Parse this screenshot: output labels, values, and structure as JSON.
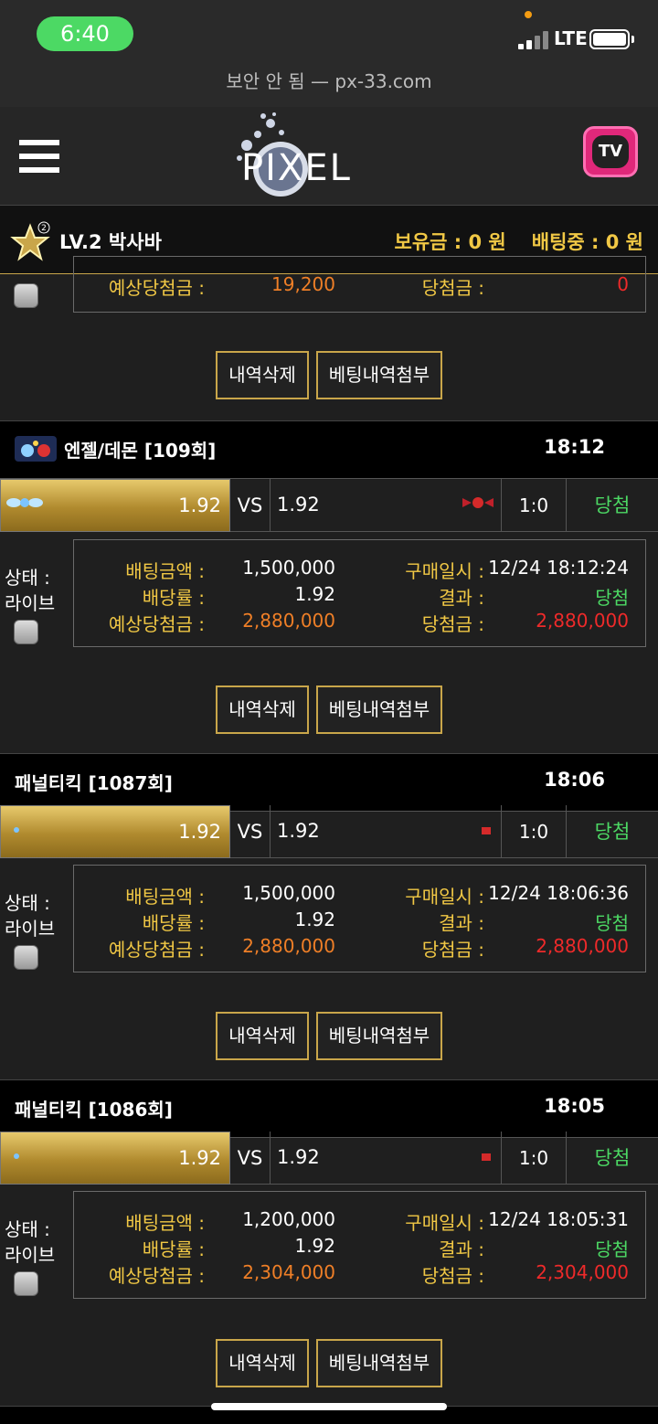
{
  "status_bar": {
    "time": "6:40",
    "network": "LTE"
  },
  "browser": {
    "url_text": "보안 안 됨 — px-33.com"
  },
  "header": {
    "logo_text": "PIXEL",
    "tv_label": "TV"
  },
  "user": {
    "level_name": "LV.2 박사바",
    "level_badge": "2",
    "balance": "보유금 : 0 원",
    "betting": "배팅중 : 0 원"
  },
  "labels": {
    "status_line1": "상태 :",
    "status_line2": "라이브",
    "bet_amount": "배팅금액 :",
    "odds": "배당률 :",
    "expected_win": "예상당첨금 :",
    "purchase_time": "구매일시 :",
    "result": "결과 :",
    "win_amount": "당첨금 :",
    "vs": "VS",
    "delete_button": "내역삭제",
    "attach_button": "베팅내역첨부"
  },
  "partial_card": {
    "expected_win": "19,200",
    "win_amount": "0"
  },
  "cards": [
    {
      "title": "엔젤/데몬 [109회]",
      "time": "18:12",
      "home_odds": "1.92",
      "away_odds": "1.92",
      "score": "1:0",
      "outcome": "당첨",
      "bet_amount": "1,500,000",
      "odds": "1.92",
      "expected_win": "2,880,000",
      "purchase_time": "12/24 18:12:24",
      "result": "당첨",
      "win_amount": "2,880,000"
    },
    {
      "title": "패널티킥 [1087회]",
      "time": "18:06",
      "home_odds": "1.92",
      "away_odds": "1.92",
      "score": "1:0",
      "outcome": "당첨",
      "bet_amount": "1,500,000",
      "odds": "1.92",
      "expected_win": "2,880,000",
      "purchase_time": "12/24 18:06:36",
      "result": "당첨",
      "win_amount": "2,880,000"
    },
    {
      "title": "패널티킥 [1086회]",
      "time": "18:05",
      "home_odds": "1.92",
      "away_odds": "1.92",
      "score": "1:0",
      "outcome": "당첨",
      "bet_amount": "1,200,000",
      "odds": "1.92",
      "expected_win": "2,304,000",
      "purchase_time": "12/24 18:05:31",
      "result": "당첨",
      "win_amount": "2,304,000"
    }
  ],
  "colors": {
    "gold": "#f1c845",
    "win_green": "#4cd964",
    "amount_orange": "#ef7f27",
    "amount_red": "#ee2a2a"
  }
}
